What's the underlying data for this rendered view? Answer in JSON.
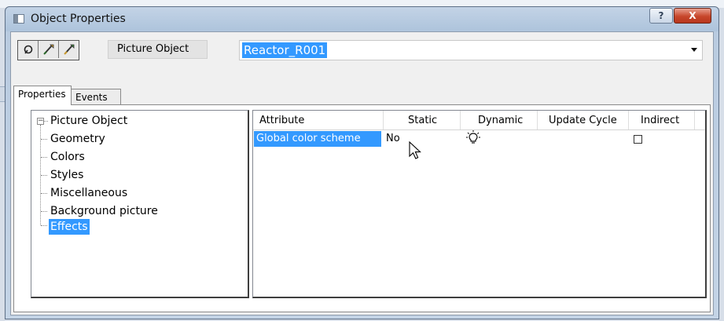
{
  "window": {
    "title": "Object Properties",
    "help_label": "?",
    "close_label": "X"
  },
  "toolbar": {
    "object_type": "Picture Object",
    "object_name": "Reactor_R001"
  },
  "tabs": [
    {
      "label": "Properties",
      "active": true
    },
    {
      "label": "Events",
      "active": false
    }
  ],
  "tree": {
    "root": "Picture Object",
    "children": [
      "Geometry",
      "Colors",
      "Styles",
      "Miscellaneous",
      "Background picture",
      "Effects"
    ],
    "selected": "Effects"
  },
  "grid": {
    "columns": [
      "Attribute",
      "Static",
      "Dynamic",
      "Update Cycle",
      "Indirect"
    ],
    "rows": [
      {
        "attribute": "Global color scheme",
        "static": "No",
        "dynamic_icon": "lightbulb-icon",
        "update_cycle": "",
        "indirect_checked": false
      }
    ]
  },
  "colors": {
    "selection": "#3399ff",
    "close_button": "#c7462b"
  }
}
